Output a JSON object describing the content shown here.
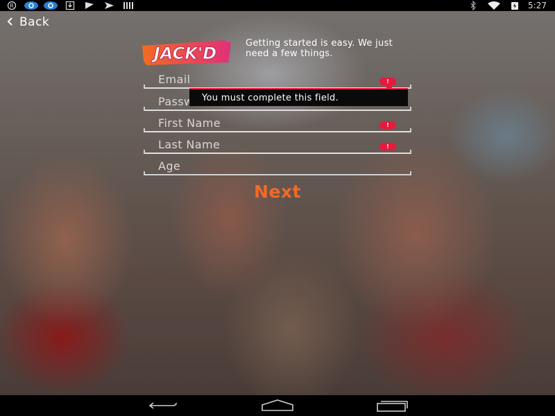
{
  "status_bar": {
    "left_icons": [
      "registered-icon",
      "app-icon",
      "app-icon",
      "download-icon",
      "flag-icon",
      "send-icon",
      "barcode-icon"
    ],
    "right_icons": [
      "bluetooth-icon",
      "wifi-icon",
      "battery-icon"
    ],
    "time": "5:27"
  },
  "action_bar": {
    "back_label": "Back"
  },
  "header": {
    "logo_text": "JACK'D",
    "intro_text": "Getting started is easy. We just need a few things."
  },
  "form": {
    "fields": [
      {
        "label": "Email",
        "error": true
      },
      {
        "label": "Password",
        "error": true
      },
      {
        "label": "First Name",
        "error": true
      },
      {
        "label": "Last Name",
        "error": true
      },
      {
        "label": "Age",
        "error": false
      }
    ],
    "error_badge": "!",
    "tooltip": "You must complete this field.",
    "next_label": "Next"
  },
  "nav_bar": {
    "buttons": [
      "back-icon",
      "home-icon",
      "recent-apps-icon"
    ]
  },
  "colors": {
    "accent_orange": "#f06a2a",
    "error_red": "#e8193c",
    "logo_pink": "#e0307a",
    "logo_orange": "#f36b21"
  }
}
